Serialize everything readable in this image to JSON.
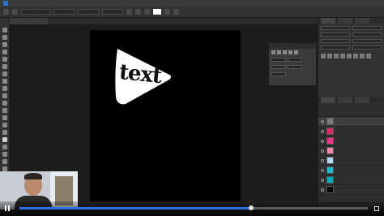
{
  "app": {
    "menu": [],
    "accent": "#2f6fe0"
  },
  "canvas": {
    "badge_text": "text",
    "background": "#000000",
    "badge_color": "#ffffff"
  },
  "layers": {
    "items": [
      {
        "thumb": "#7a7a7a"
      },
      {
        "thumb": "#d62b6a"
      },
      {
        "thumb": "#e8388b"
      },
      {
        "thumb": "#f28ab0"
      },
      {
        "thumb": "#b7d9f0"
      },
      {
        "thumb": "#22b8cf"
      },
      {
        "thumb": "#13a8c2"
      },
      {
        "thumb": "#000000"
      }
    ]
  },
  "video": {
    "progress_fraction": 0.66,
    "time_tooltip": ""
  },
  "icons": {
    "play_pause": "pause-icon",
    "fullscreen": "fullscreen-icon"
  }
}
